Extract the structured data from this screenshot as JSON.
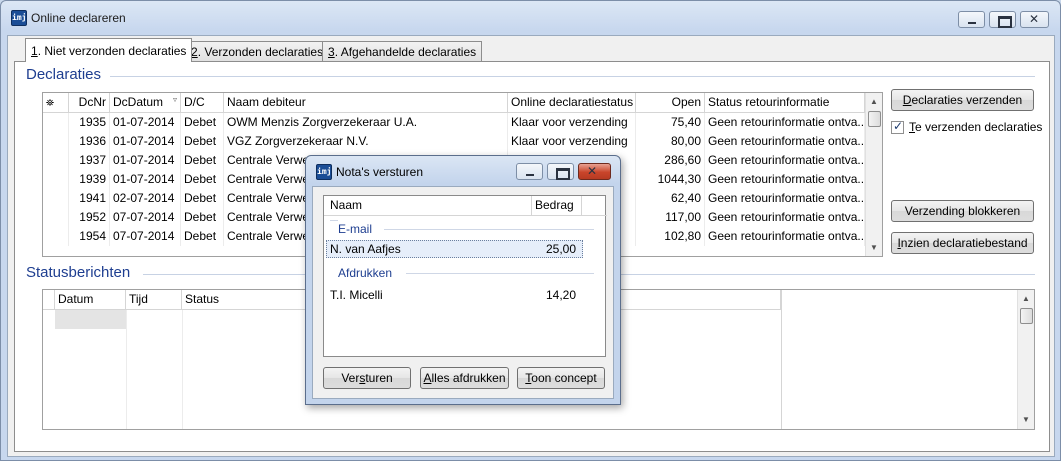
{
  "window": {
    "title": "Online declareren",
    "app_icon": "imj"
  },
  "tabs": [
    {
      "hotkey": "1",
      "label": ". Niet verzonden declaraties"
    },
    {
      "hotkey": "2",
      "label": ". Verzonden declaraties"
    },
    {
      "hotkey": "3",
      "label": ". Afgehandelde declaraties"
    }
  ],
  "declaraties": {
    "section_title": "Declaraties",
    "columns": [
      "",
      "DcNr",
      "DcDatum",
      "D/C",
      "Naam debiteur",
      "Online declaratiestatus",
      "Open",
      "Status retourinformatie"
    ],
    "rows": [
      [
        "1935",
        "01-07-2014",
        "Debet",
        "OWM Menzis Zorgverzekeraar U.A.",
        "Klaar voor verzending",
        "75,40",
        "Geen retourinformatie ontva..."
      ],
      [
        "1936",
        "01-07-2014",
        "Debet",
        "VGZ Zorgverzekeraar N.V.",
        "Klaar voor verzending",
        "80,00",
        "Geen retourinformatie ontva..."
      ],
      [
        "1937",
        "01-07-2014",
        "Debet",
        "Centrale Verwerk",
        "",
        "286,60",
        "Geen retourinformatie ontva..."
      ],
      [
        "1939",
        "01-07-2014",
        "Debet",
        "Centrale Verwerk",
        "",
        "1044,30",
        "Geen retourinformatie ontva..."
      ],
      [
        "1941",
        "02-07-2014",
        "Debet",
        "Centrale Verwerk",
        "",
        "62,40",
        "Geen retourinformatie ontva..."
      ],
      [
        "1952",
        "07-07-2014",
        "Debet",
        "Centrale Verwerk",
        "",
        "117,00",
        "Geen retourinformatie ontva..."
      ],
      [
        "1954",
        "07-07-2014",
        "Debet",
        "Centrale Verwerk",
        "",
        "102,80",
        "Geen retourinformatie ontva..."
      ]
    ]
  },
  "side": {
    "send_button": {
      "hotkey": "D",
      "rest": "eclaraties verzenden"
    },
    "checkbox": {
      "hotkey": "T",
      "rest": "e verzenden declaraties",
      "checked": true
    },
    "block_button": "Verzending blokkeren",
    "view_file_button": {
      "hotkey": "I",
      "rest": "nzien declaratiebestand"
    }
  },
  "status": {
    "section_title": "Statusberichten",
    "columns": [
      "Datum",
      "Tijd",
      "Status"
    ]
  },
  "dialog": {
    "title": "Nota's versturen",
    "columns": [
      "Naam",
      "Bedrag"
    ],
    "groups": [
      {
        "label": "E-mail",
        "items": [
          {
            "name": "N. van Aafjes",
            "amount": "25,00"
          }
        ]
      },
      {
        "label": "Afdrukken",
        "items": [
          {
            "name": "T.I. Micelli",
            "amount": "14,20"
          }
        ]
      }
    ],
    "buttons": {
      "send": {
        "pre": "Ver",
        "hotkey": "s",
        "post": "turen"
      },
      "print_all": {
        "hotkey": "A",
        "rest": "lles afdrukken"
      },
      "show_concept": {
        "hotkey": "T",
        "rest": "oon concept"
      }
    }
  }
}
